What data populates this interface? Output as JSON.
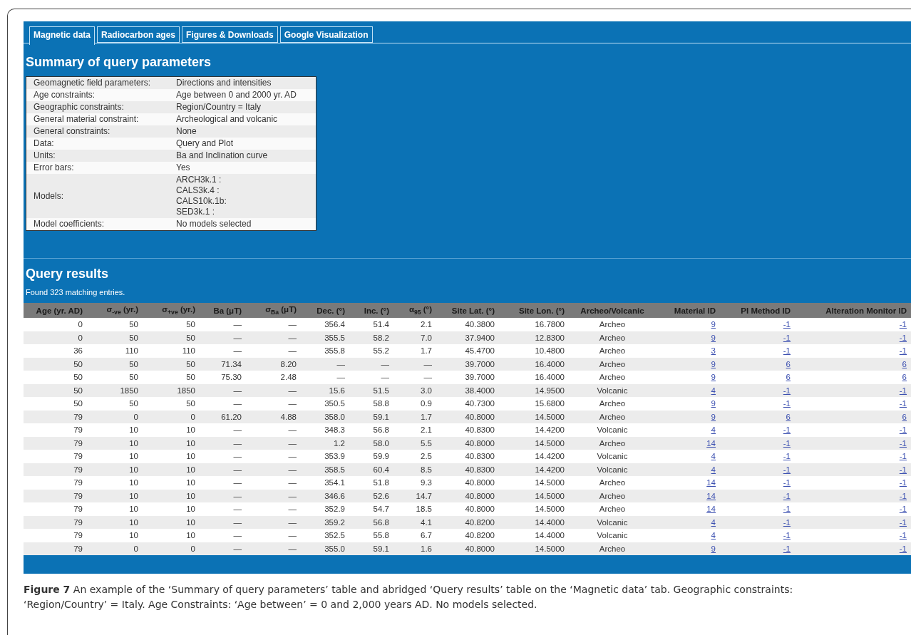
{
  "tabs": [
    {
      "label": "Magnetic data",
      "selected": true
    },
    {
      "label": "Radiocarbon ages",
      "selected": false
    },
    {
      "label": "Figures & Downloads",
      "selected": false
    },
    {
      "label": "Google Visualization",
      "selected": false
    }
  ],
  "summary": {
    "title": "Summary of query parameters",
    "rows": [
      {
        "label": "Geomagnetic field parameters:",
        "value": [
          "Directions and intensities"
        ]
      },
      {
        "label": "Age constraints:",
        "value": [
          "Age between 0 and 2000 yr. AD"
        ]
      },
      {
        "label": "Geographic constraints:",
        "value": [
          "Region/Country = Italy"
        ]
      },
      {
        "label": "General material constraint:",
        "value": [
          "Archeological and volcanic"
        ]
      },
      {
        "label": "General constraints:",
        "value": [
          "None"
        ]
      },
      {
        "label": "Data:",
        "value": [
          "Query and Plot"
        ]
      },
      {
        "label": "Units:",
        "value": [
          "Ba and Inclination curve"
        ]
      },
      {
        "label": "Error bars:",
        "value": [
          "Yes"
        ]
      },
      {
        "label": "Models:",
        "value": [
          "ARCH3k.1 :",
          "CALS3k.4 :",
          "CALS10k.1b:",
          "SED3k.1 :"
        ]
      },
      {
        "label": "Model coefficients:",
        "value": [
          "No models selected"
        ]
      }
    ]
  },
  "results": {
    "title": "Query results",
    "count_text": "Found 323 matching entries.",
    "columns": [
      {
        "label": "Age (yr. AD)",
        "kind": "number"
      },
      {
        "label": "σ$_{-ve}$ (yr.)",
        "kind": "number"
      },
      {
        "label": "σ$_{+ve}$ (yr.)",
        "kind": "number"
      },
      {
        "label": "Ba (μT)",
        "kind": "number"
      },
      {
        "label": "σ$_{Ba}$ (μT)",
        "kind": "number"
      },
      {
        "label": "Dec. (°)",
        "kind": "number"
      },
      {
        "label": "Inc. (°)",
        "kind": "number"
      },
      {
        "label": "α$_{95}$ (°)",
        "kind": "number"
      },
      {
        "label": "Site Lat. (°)",
        "kind": "number"
      },
      {
        "label": "Site Lon. (°)",
        "kind": "number"
      },
      {
        "label": "Archeo/Volcanic",
        "kind": "text"
      },
      {
        "label": "Material ID",
        "kind": "link"
      },
      {
        "label": "PI Method ID",
        "kind": "link"
      },
      {
        "label": "Alteration Monitor ID",
        "kind": "link"
      }
    ],
    "rows": [
      [
        "0",
        "50",
        "50",
        "—",
        "—",
        "356.4",
        "51.4",
        "2.1",
        "40.3800",
        "16.7800",
        "Archeo",
        "9",
        "-1",
        "-1"
      ],
      [
        "0",
        "50",
        "50",
        "—",
        "—",
        "355.5",
        "58.2",
        "7.0",
        "37.9400",
        "12.8300",
        "Archeo",
        "9",
        "-1",
        "-1"
      ],
      [
        "36",
        "110",
        "110",
        "—",
        "—",
        "355.8",
        "55.2",
        "1.7",
        "45.4700",
        "10.4800",
        "Archeo",
        "3",
        "-1",
        "-1"
      ],
      [
        "50",
        "50",
        "50",
        "71.34",
        "8.20",
        "—",
        "—",
        "—",
        "39.7000",
        "16.4000",
        "Archeo",
        "9",
        "6",
        "6"
      ],
      [
        "50",
        "50",
        "50",
        "75.30",
        "2.48",
        "—",
        "—",
        "—",
        "39.7000",
        "16.4000",
        "Archeo",
        "9",
        "6",
        "6"
      ],
      [
        "50",
        "1850",
        "1850",
        "—",
        "—",
        "15.6",
        "51.5",
        "3.0",
        "38.4000",
        "14.9500",
        "Volcanic",
        "4",
        "-1",
        "-1"
      ],
      [
        "50",
        "50",
        "50",
        "—",
        "—",
        "350.5",
        "58.8",
        "0.9",
        "40.7300",
        "15.6800",
        "Archeo",
        "9",
        "-1",
        "-1"
      ],
      [
        "79",
        "0",
        "0",
        "61.20",
        "4.88",
        "358.0",
        "59.1",
        "1.7",
        "40.8000",
        "14.5000",
        "Archeo",
        "9",
        "6",
        "6"
      ],
      [
        "79",
        "10",
        "10",
        "—",
        "—",
        "348.3",
        "56.8",
        "2.1",
        "40.8300",
        "14.4200",
        "Volcanic",
        "4",
        "-1",
        "-1"
      ],
      [
        "79",
        "10",
        "10",
        "—",
        "—",
        "1.2",
        "58.0",
        "5.5",
        "40.8000",
        "14.5000",
        "Archeo",
        "14",
        "-1",
        "-1"
      ],
      [
        "79",
        "10",
        "10",
        "—",
        "—",
        "353.9",
        "59.9",
        "2.5",
        "40.8300",
        "14.4200",
        "Volcanic",
        "4",
        "-1",
        "-1"
      ],
      [
        "79",
        "10",
        "10",
        "—",
        "—",
        "358.5",
        "60.4",
        "8.5",
        "40.8300",
        "14.4200",
        "Volcanic",
        "4",
        "-1",
        "-1"
      ],
      [
        "79",
        "10",
        "10",
        "—",
        "—",
        "354.1",
        "51.8",
        "9.3",
        "40.8000",
        "14.5000",
        "Archeo",
        "14",
        "-1",
        "-1"
      ],
      [
        "79",
        "10",
        "10",
        "—",
        "—",
        "346.6",
        "52.6",
        "14.7",
        "40.8000",
        "14.5000",
        "Archeo",
        "14",
        "-1",
        "-1"
      ],
      [
        "79",
        "10",
        "10",
        "—",
        "—",
        "352.9",
        "54.7",
        "18.5",
        "40.8000",
        "14.5000",
        "Archeo",
        "14",
        "-1",
        "-1"
      ],
      [
        "79",
        "10",
        "10",
        "—",
        "—",
        "359.2",
        "56.8",
        "4.1",
        "40.8200",
        "14.4000",
        "Volcanic",
        "4",
        "-1",
        "-1"
      ],
      [
        "79",
        "10",
        "10",
        "—",
        "—",
        "352.5",
        "55.8",
        "6.7",
        "40.8200",
        "14.4000",
        "Volcanic",
        "4",
        "-1",
        "-1"
      ],
      [
        "79",
        "0",
        "0",
        "—",
        "—",
        "355.0",
        "59.1",
        "1.6",
        "40.8000",
        "14.5000",
        "Archeo",
        "9",
        "-1",
        "-1"
      ]
    ]
  },
  "caption": "**Figure 7**  An example of the ‘Summary of query parameters’ table and abridged ‘Query results’ table on the ‘Magnetic data’ tab. Geographic constraints: ‘Region/Country’ = Italy. Age Constraints: ‘Age between’ = 0 and 2,000 years AD. No models selected."
}
